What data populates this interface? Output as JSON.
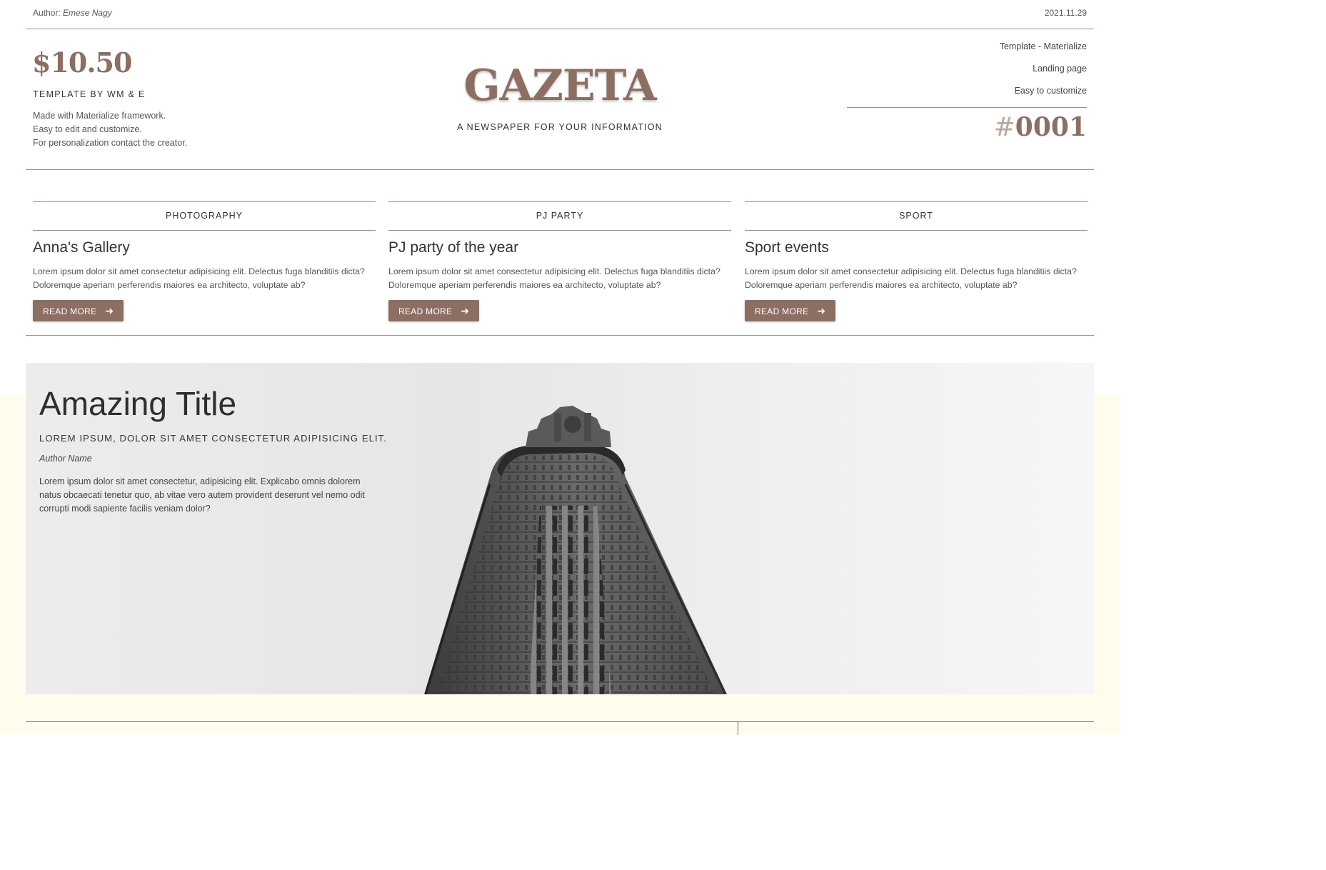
{
  "topbar": {
    "author_label": "Author:",
    "author_name": "Emese Nagy",
    "date": "2021.11.29"
  },
  "masthead": {
    "price": "$10.50",
    "template_by": "TEMPLATE BY WM & E",
    "description_lines": [
      "Made with Materialize framework.",
      "Easy to edit and customize.",
      "For personalization contact the creator."
    ],
    "logo": "GAZETA",
    "tagline": "A NEWSPAPER FOR YOUR INFORMATION",
    "right_links": [
      "Template - Materialize",
      "Landing page",
      "Easy to customize"
    ],
    "issue_hash": "#",
    "issue_number": "0001"
  },
  "articles": [
    {
      "category": "PHOTOGRAPHY",
      "title": "Anna's Gallery",
      "text_lines": [
        "Lorem ipsum dolor sit amet consectetur adipisicing elit. Delectus fuga blanditiis dicta?",
        "Doloremque aperiam perferendis maiores ea architecto, voluptate ab?"
      ],
      "button": "READ MORE"
    },
    {
      "category": "PJ PARTY",
      "title": "PJ party of the year",
      "text_lines": [
        "Lorem ipsum dolor sit amet consectetur adipisicing elit. Delectus fuga blanditiis dicta?",
        "Doloremque aperiam perferendis maiores ea architecto, voluptate ab?"
      ],
      "button": "READ MORE"
    },
    {
      "category": "SPORT",
      "title": "Sport events",
      "text_lines": [
        "Lorem ipsum dolor sit amet consectetur adipisicing elit. Delectus fuga blanditiis dicta?",
        "Doloremque aperiam perferendis maiores ea architecto, voluptate ab?"
      ],
      "button": "READ MORE"
    }
  ],
  "hero": {
    "title": "Amazing Title",
    "subtitle": "LOREM IPSUM, DOLOR SIT AMET CONSECTETUR ADIPISICING ELIT.",
    "author": "Author Name",
    "text_lines": [
      "Lorem ipsum dolor sit amet consectetur, adipisicing elit. Explicabo omnis dolorem",
      "natus obcaecati tenetur quo, ab vitae vero autem provident deserunt vel nemo odit",
      "corrupti modi sapiente facilis veniam dolor?"
    ],
    "image": "flatiron-building-photo"
  },
  "icons": {
    "button_arrow": "arrow-right-icon"
  },
  "colors": {
    "accent": "#8d6e63",
    "rule": "#a08e86",
    "cream": "#fffcee"
  }
}
